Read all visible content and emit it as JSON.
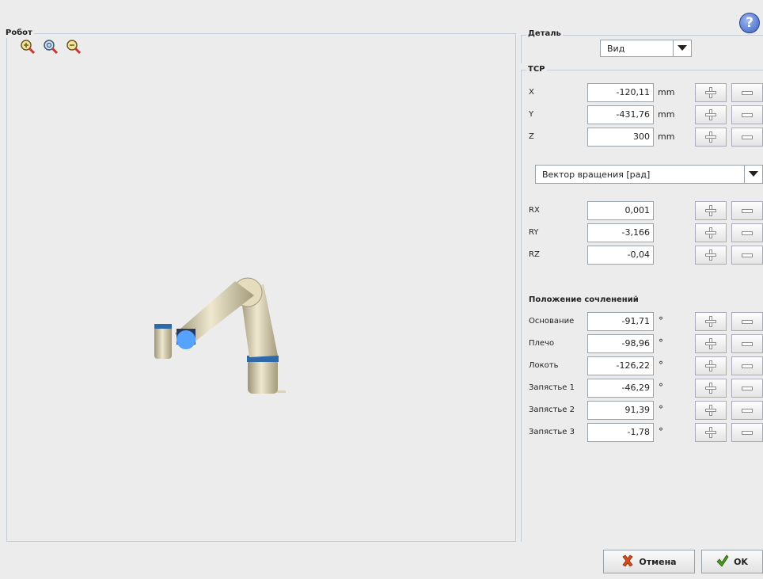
{
  "robot_panel": {
    "title": "Робот"
  },
  "zoom": [
    "zoom-in-icon",
    "zoom-reset-icon",
    "zoom-out-icon"
  ],
  "detail": {
    "title": "Деталь",
    "view_value": "Вид"
  },
  "tcp": {
    "title": "TCP",
    "position": [
      {
        "label": "X",
        "value": "-120,11",
        "unit": "mm"
      },
      {
        "label": "Y",
        "value": "-431,76",
        "unit": "mm"
      },
      {
        "label": "Z",
        "value": "300",
        "unit": "mm"
      }
    ],
    "rotation_mode": "Вектор вращения [рад]",
    "rotation": [
      {
        "label": "RX",
        "value": "0,001"
      },
      {
        "label": "RY",
        "value": "-3,166"
      },
      {
        "label": "RZ",
        "value": "-0,04"
      }
    ]
  },
  "joints": {
    "title": "Положение сочленений",
    "unit": "°",
    "items": [
      {
        "label": "Основание",
        "value": "-91,71"
      },
      {
        "label": "Плечо",
        "value": "-98,96"
      },
      {
        "label": "Локоть",
        "value": "-126,22"
      },
      {
        "label": "Запястье 1",
        "value": "-46,29"
      },
      {
        "label": "Запястье 2",
        "value": "91,39"
      },
      {
        "label": "Запястье 3",
        "value": "-1,78"
      }
    ]
  },
  "buttons": {
    "cancel": "Отмена",
    "ok": "OK"
  },
  "help": {
    "glyph": "?"
  },
  "colors": {
    "accent": "#3a5fc0",
    "cancel_icon": "#d94a1a",
    "ok_icon": "#4a9a1e",
    "panel_border": "#c3ccd6"
  }
}
